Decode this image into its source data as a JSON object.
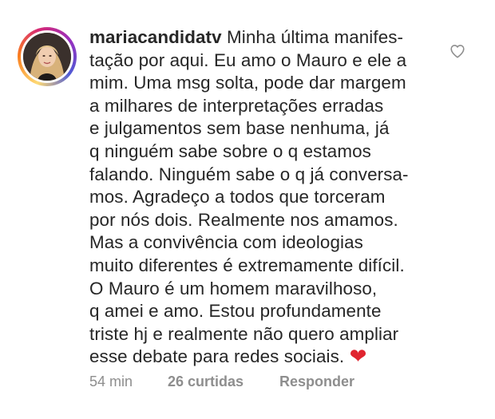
{
  "comment": {
    "username": "mariacandidatv",
    "text_lines": [
      "Minha última manifes-",
      "tação por aqui. Eu amo o Mauro e ele a",
      "mim. Uma msg solta, pode dar margem",
      "a milhares de interpretações erradas",
      "e julgamentos sem base nenhuma, já",
      "q ninguém sabe sobre o q estamos",
      "falando. Ninguém sabe o q já conversa-",
      "mos.  Agradeço a todos que torceram",
      "por nós dois. Realmente nos amamos.",
      "Mas a convivência com ideologias",
      "muito diferentes é extremamente difícil.",
      "O Mauro é um homem maravilhoso,",
      "q amei e amo. Estou profundamente",
      "triste hj e realmente não quero ampliar",
      "esse debate para redes sociais."
    ],
    "emoji": "❤",
    "time": "54 min",
    "likes": "26 curtidas",
    "reply_label": "Responder"
  },
  "icons": {
    "avatar": "profile-photo",
    "like": "heart-outline-icon"
  },
  "colors": {
    "text": "#262626",
    "meta": "#8e8e8e",
    "emoji_heart": "#e0242f",
    "like_icon": "#8e8e8e"
  }
}
